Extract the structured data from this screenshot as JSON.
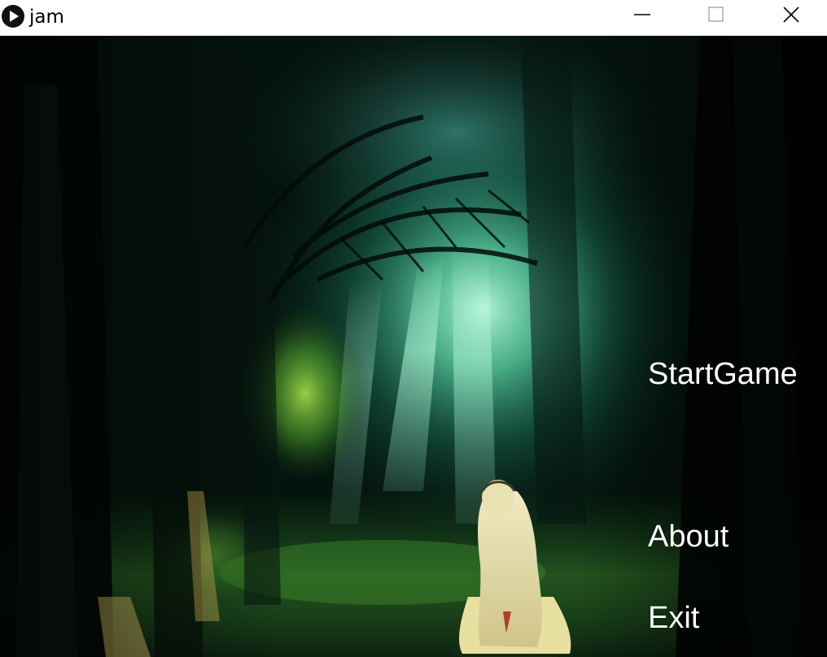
{
  "window": {
    "title": "jam",
    "icon": "play-circle-icon",
    "controls": [
      "minimize-icon",
      "maximize-icon",
      "close-icon"
    ]
  },
  "menu": {
    "start_label": "StartGame",
    "about_label": "About",
    "exit_label": "Exit"
  },
  "scene": {
    "description_icons": [
      "forest-background",
      "girl-character"
    ],
    "accent_colors": {
      "light": "#8ff5c8",
      "foliage": "#6fbf3a",
      "dark": "#020805",
      "hair": "#e8e2b0"
    }
  }
}
